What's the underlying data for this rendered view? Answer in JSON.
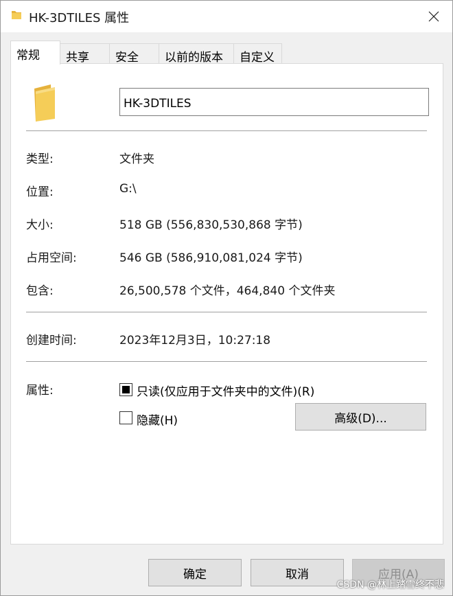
{
  "window": {
    "title": "HK-3DTILES 属性"
  },
  "tabs": [
    {
      "label": "常规",
      "active": true
    },
    {
      "label": "共享"
    },
    {
      "label": "安全"
    },
    {
      "label": "以前的版本"
    },
    {
      "label": "自定义"
    }
  ],
  "general": {
    "name_value": "HK-3DTILES",
    "type_label": "类型:",
    "type_value": "文件夹",
    "location_label": "位置:",
    "location_value": "G:\\",
    "size_label": "大小:",
    "size_value": "518 GB (556,830,530,868 字节)",
    "disk_label": "占用空间:",
    "disk_value": "546 GB (586,910,081,024 字节)",
    "contains_label": "包含:",
    "contains_value": "26,500,578 个文件，464,840 个文件夹",
    "created_label": "创建时间:",
    "created_value": "2023年12月3日，10:27:18",
    "attributes_label": "属性:",
    "readonly_label": "只读(仅应用于文件夹中的文件)(R)",
    "hidden_label": "隐藏(H)",
    "advanced_label": "高级(D)..."
  },
  "footer": {
    "ok_label": "确定",
    "cancel_label": "取消",
    "apply_label": "应用(A)"
  },
  "watermark": "CSDN @林上踏雪终不悲",
  "colors": {
    "folder": "#f5cd58",
    "folder_dark": "#e6b23c"
  }
}
